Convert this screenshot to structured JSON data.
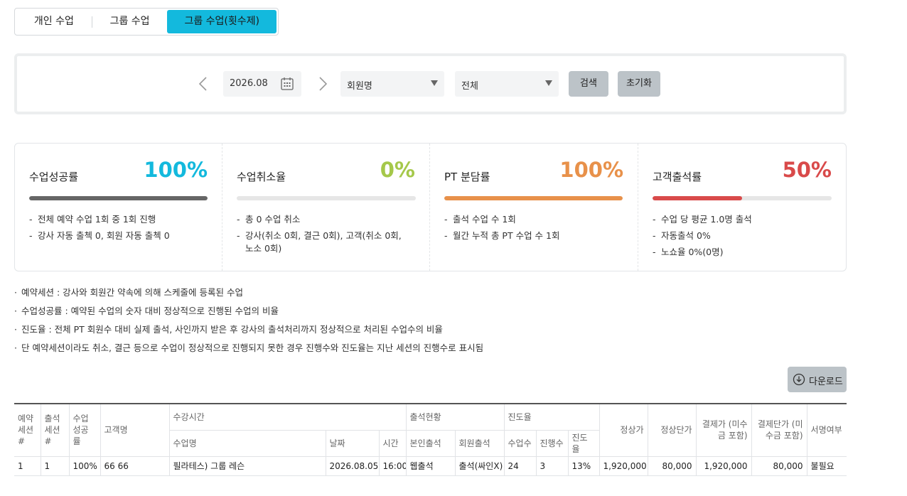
{
  "tabs": [
    "개인 수업",
    "그룹 수업",
    "그룹 수업(횟수제)"
  ],
  "active_tab_color": "#13b9dd",
  "search": {
    "date": "2026.08",
    "member_select": "회원명",
    "status_select": "전체",
    "search_label": "검색",
    "reset_label": "초기화"
  },
  "stats": [
    {
      "title": "수업성공률",
      "value": "100%",
      "progress": 1.0,
      "color": "#13b9dd",
      "bar_color": "#666666",
      "lines": [
        "전체 예약 수업 1회 중 1회 진행",
        "강사 자동 출첵 0, 회원 자동 출첵 0"
      ]
    },
    {
      "title": "수업취소율",
      "value": "0%",
      "progress": 0.0,
      "color": "#a5c84a",
      "bar_color": "#a5c84a",
      "lines": [
        "총 0 수업 취소",
        "강사(취소 0회, 결근 0회), 고객(취소 0회, 노소 0회)"
      ]
    },
    {
      "title": "PT 분담률",
      "value": "100%",
      "progress": 1.0,
      "color": "#e8914a",
      "bar_color": "#e8914a",
      "lines": [
        "출석 수업 수 1회",
        "월간 누적 총 PT 수업 수 1회"
      ]
    },
    {
      "title": "고객출석률",
      "value": "50%",
      "progress": 0.5,
      "color": "#d94a4a",
      "bar_color": "#d94a4a",
      "lines": [
        "수업 당 평균 1.0명 출석",
        "자동출석 0%",
        "노쇼율 0%(0명)"
      ]
    }
  ],
  "notes": [
    "예약세션 : 강사와 회원간 약속에 의해 스케줄에 등록된 수업",
    "수업성공률 : 예약된 수업의 숫자 대비 정상적으로 진행된 수업의 비율",
    "진도율 : 전체 PT 회원수 대비 실제 출석, 사인까지 받은 후 강사의 출석처리까지 정상적으로 처리된 수업수의 비율",
    "단 예약세션이라도 취소, 결근 등으로 수업이 정상적으로 진행되지 못한 경우 진행수와 진도율는 지난 세션의 진행수로 표시됨"
  ],
  "download_label": "다운로드",
  "table": {
    "headers": {
      "reserve_session": "예약 세션#",
      "attend_session": "출석 세션#",
      "success_rate": "수업 성공률",
      "customer": "고객명",
      "class_time": "수강시간",
      "attendance": "출석현황",
      "progress": "진도율",
      "list_price": "정상가",
      "unit_price": "정상단가",
      "payment": "결제가 (미수금 포함)",
      "payment_unit": "결제단가 (미수금 포함)",
      "signature": "서명여부",
      "class_name": "수업명",
      "date": "날짜",
      "time": "시간",
      "self_attend": "본인출석",
      "member_attend": "회원출석",
      "class_count": "수업수",
      "done_count": "진행수",
      "progress_rate": "진도율"
    },
    "rows": [
      {
        "reserve": "1",
        "attend": "1",
        "success": "100%",
        "customer": "66 66",
        "class_name": "필라테스) 그룹 레슨",
        "date": "2026.08.05",
        "time": "16:00",
        "self_attend": "웹출석",
        "member_attend": "출석(싸인X)",
        "class_count": "24",
        "done_count": "3",
        "progress_rate": "13%",
        "list_price": "1,920,000",
        "unit_price": "80,000",
        "payment": "1,920,000",
        "payment_unit": "80,000",
        "signature": "불필요"
      }
    ]
  }
}
